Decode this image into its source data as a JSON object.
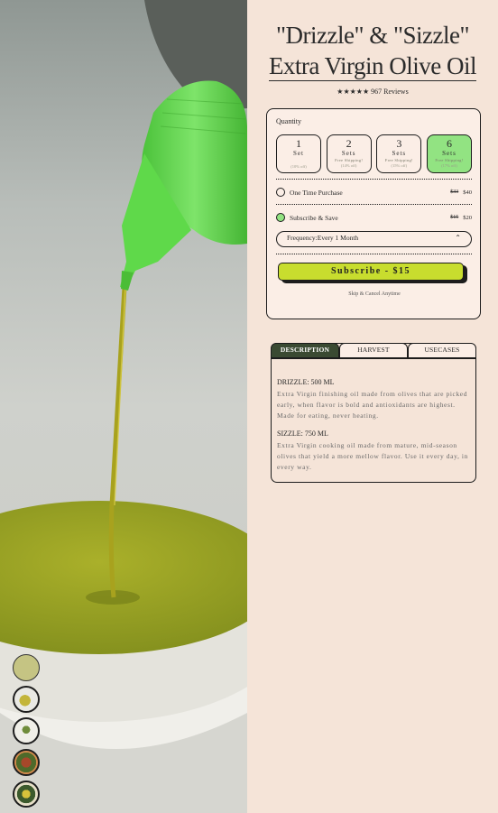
{
  "product": {
    "title_line1": "\"Drizzle\" & \"Sizzle\"",
    "title_line2": "Extra Virgin Olive Oil",
    "stars": "★★★★★",
    "reviews": "967 Reviews"
  },
  "quantity": {
    "label": "Quantity",
    "options": [
      {
        "num": "1",
        "unit": "Set",
        "note": "",
        "off": "(10% off)"
      },
      {
        "num": "2",
        "unit": "Sets",
        "note": "Free Shipping!",
        "off": "(14% off)"
      },
      {
        "num": "3",
        "unit": "Sets",
        "note": "Free Shipping!",
        "off": "(15% off)"
      },
      {
        "num": "6",
        "unit": "Sets",
        "note": "Free Shipping!",
        "off": "(17% off)"
      }
    ],
    "selected_index": 3
  },
  "purchase": {
    "one_time_label": "One Time Purchase",
    "one_time_old": "$33",
    "one_time_price": "$40",
    "subscribe_label": "Subscribe & Save",
    "subscribe_old": "$15",
    "subscribe_price": "$20",
    "frequency_label": "Frequency:",
    "frequency_value": "Every 1 Month",
    "button_label": "Subscribe - $15",
    "skip_text": "Skip & Cancel Anytime"
  },
  "tabs": {
    "items": [
      "DESCRIPTION",
      "HARVEST",
      "USECASES"
    ],
    "active_index": 0
  },
  "description": {
    "drizzle_title": "DRIZZLE: 500 ML",
    "drizzle_text": "Extra Virgin finishing oil made from olives that are picked early, when flavor is bold and antioxidants are highest. Made for eating, never heating.",
    "sizzle_title": "SIZZLE: 750 ML",
    "sizzle_text": "Extra Virgin cooking oil made from mature, mid-season olives that yield a more mellow flavor. Use it every day, in every way."
  },
  "colors": {
    "background": "#f5e4d8",
    "selected_green": "#92e382",
    "button_lime": "#c8dd2e",
    "tab_active": "#3a4a32",
    "bottle_green": "#5fd94a",
    "oil": "#9aa51f"
  }
}
